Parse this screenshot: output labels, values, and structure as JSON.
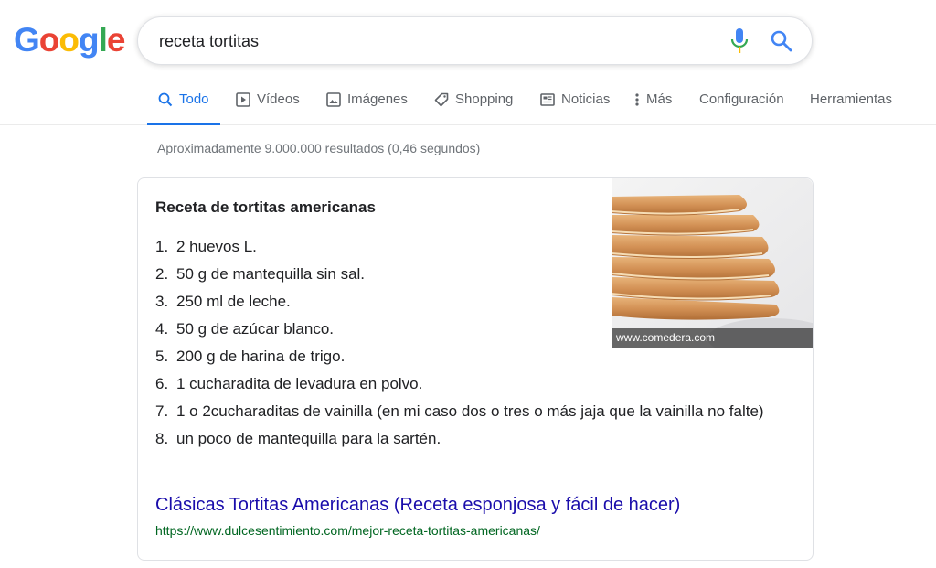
{
  "logo": {
    "letters": [
      "G",
      "o",
      "o",
      "g",
      "l",
      "e"
    ]
  },
  "search": {
    "query": "receta tortitas"
  },
  "tabs": [
    {
      "label": "Todo",
      "icon": "search-icon"
    },
    {
      "label": "Vídeos",
      "icon": "play-icon"
    },
    {
      "label": "Imágenes",
      "icon": "image-icon"
    },
    {
      "label": "Shopping",
      "icon": "tag-icon"
    },
    {
      "label": "Noticias",
      "icon": "news-icon"
    },
    {
      "label": "Más",
      "icon": "more-vert-icon"
    },
    {
      "label": "Configuración"
    },
    {
      "label": "Herramientas"
    }
  ],
  "stats": "Aproximadamente 9.000.000 resultados (0,46 segundos)",
  "snippet": {
    "title": "Receta de tortitas americanas",
    "items": [
      {
        "n": "1.",
        "text": "2 huevos L."
      },
      {
        "n": "2.",
        "text": "50 g de mantequilla sin sal."
      },
      {
        "n": "3.",
        "text": "250 ml de leche."
      },
      {
        "n": "4.",
        "text": "50 g de azúcar blanco."
      },
      {
        "n": "5.",
        "text": "200 g de harina de trigo."
      },
      {
        "n": "6.",
        "text": "1 cucharadita de levadura en polvo."
      },
      {
        "n": "7.",
        "text": "1 o 2cucharaditas de vainilla (en mi caso dos o tres o más jaja que la vainilla no falte)"
      },
      {
        "n": "8.",
        "text": "un poco de mantequilla para la sartén."
      }
    ],
    "image_credit": "www.comedera.com",
    "link_title": "Clásicas Tortitas Americanas (Receta esponjosa y fácil de hacer)",
    "link_url": "https://www.dulcesentimiento.com/mejor-receta-tortitas-americanas/"
  },
  "colors": {
    "link": "#1a0dab",
    "url": "#006621",
    "accent": "#1a73e8"
  }
}
